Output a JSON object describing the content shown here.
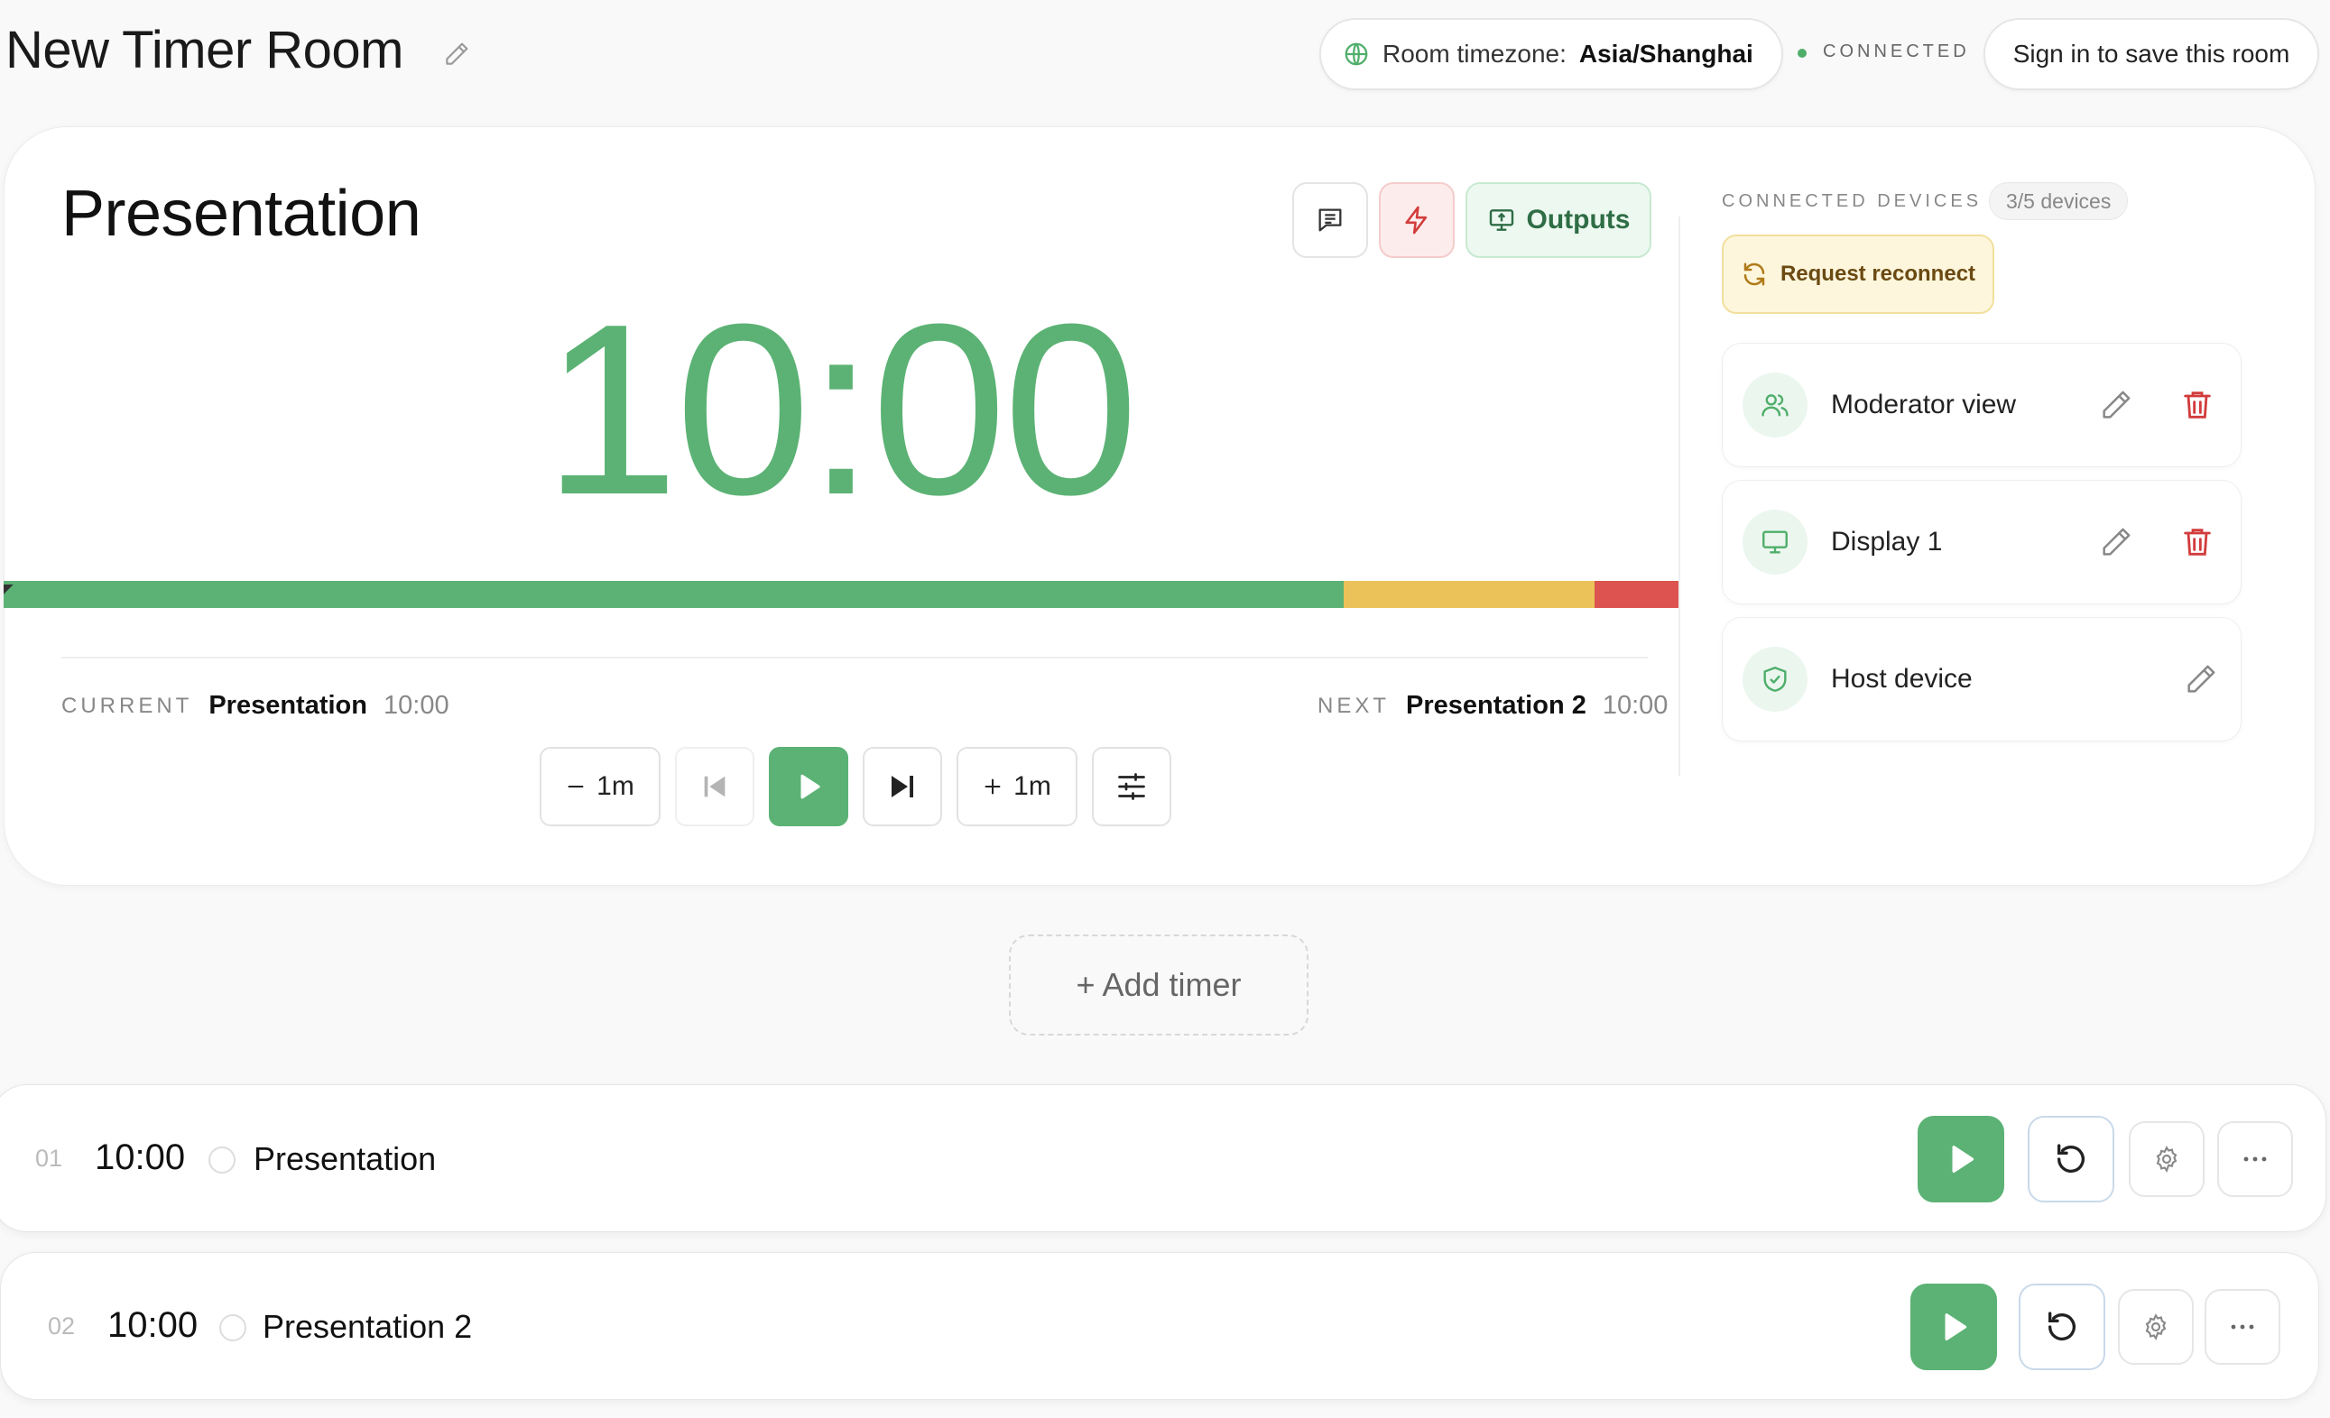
{
  "header": {
    "room_title": "New Timer Room",
    "timezone_label": "Room timezone:",
    "timezone_value": "Asia/Shanghai",
    "connection_status": "CONNECTED",
    "sign_in_label": "Sign in to save this room"
  },
  "main": {
    "timer_name": "Presentation",
    "outputs_label": "Outputs",
    "time_display": "10:00",
    "progress_segments": [
      {
        "color": "#5bb274",
        "fraction": 0.8
      },
      {
        "color": "#ebc25a",
        "fraction": 0.15
      },
      {
        "color": "#dc534f",
        "fraction": 0.05
      }
    ],
    "current": {
      "key": "CURRENT",
      "name": "Presentation",
      "duration": "10:00"
    },
    "next": {
      "key": "NEXT",
      "name": "Presentation 2",
      "duration": "10:00"
    },
    "controls": {
      "minus_label": "1m",
      "plus_label": "1m"
    }
  },
  "devices": {
    "heading": "CONNECTED DEVICES",
    "count": "3/5 devices",
    "reconnect_label": "Request reconnect",
    "items": [
      {
        "label": "Moderator view",
        "icon": "users-icon",
        "deletable": true
      },
      {
        "label": "Display 1",
        "icon": "monitor-icon",
        "deletable": true
      },
      {
        "label": "Host device",
        "icon": "shield-icon",
        "deletable": false
      }
    ]
  },
  "add_timer_label": "+ Add timer",
  "timers": [
    {
      "index": "01",
      "time": "10:00",
      "name": "Presentation"
    },
    {
      "index": "02",
      "time": "10:00",
      "name": "Presentation 2"
    }
  ],
  "colors": {
    "accent_green": "#5bb274",
    "warning_yellow": "#ebc25a",
    "danger_red": "#dc534f"
  }
}
